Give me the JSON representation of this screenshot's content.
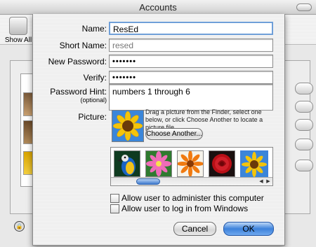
{
  "window": {
    "title": "Accounts"
  },
  "toolbar": {
    "show_all_label": "Show All",
    "show_all_icon": "apple-icon"
  },
  "form": {
    "name_label": "Name:",
    "name_value": "ResEd",
    "short_name_label": "Short Name:",
    "short_name_value": "resed",
    "new_password_label": "New Password:",
    "new_password_value": "•••••••",
    "verify_label": "Verify:",
    "verify_value": "•••••••",
    "hint_label": "Password Hint:",
    "hint_sub_label": "(optional)",
    "hint_value": "numbers 1 through 6",
    "picture_label": "Picture:",
    "picture_instructions": "Drag a picture from the Finder, select one below, or click Choose Another to locate a picture file.",
    "choose_another_label": "Choose Another...",
    "picture_thumbnails": [
      "parrot",
      "pink-flower",
      "orange-gerbera",
      "red-rose",
      "sunflower"
    ],
    "selected_picture": "sunflower"
  },
  "options": [
    {
      "label": "Allow user to administer this computer",
      "checked": false
    },
    {
      "label": "Allow user to log in from Windows",
      "checked": false
    }
  ],
  "buttons": {
    "cancel_label": "Cancel",
    "ok_label": "OK"
  },
  "colors": {
    "accent": "#3d82db",
    "focus_ring": "#6f9fd8"
  }
}
